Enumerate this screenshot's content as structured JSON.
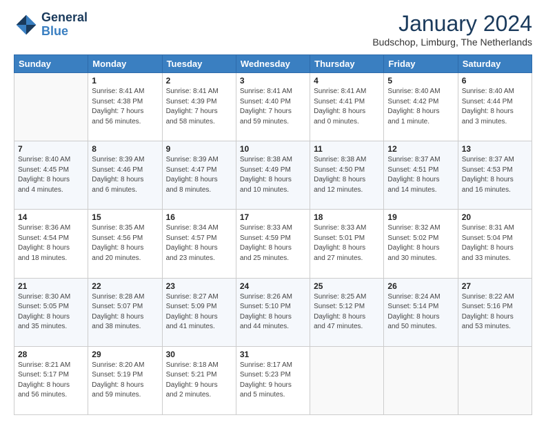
{
  "header": {
    "logo_line1": "General",
    "logo_line2": "Blue",
    "month_title": "January 2024",
    "location": "Budschop, Limburg, The Netherlands"
  },
  "days_of_week": [
    "Sunday",
    "Monday",
    "Tuesday",
    "Wednesday",
    "Thursday",
    "Friday",
    "Saturday"
  ],
  "weeks": [
    [
      {
        "day": "",
        "info": ""
      },
      {
        "day": "1",
        "info": "Sunrise: 8:41 AM\nSunset: 4:38 PM\nDaylight: 7 hours\nand 56 minutes."
      },
      {
        "day": "2",
        "info": "Sunrise: 8:41 AM\nSunset: 4:39 PM\nDaylight: 7 hours\nand 58 minutes."
      },
      {
        "day": "3",
        "info": "Sunrise: 8:41 AM\nSunset: 4:40 PM\nDaylight: 7 hours\nand 59 minutes."
      },
      {
        "day": "4",
        "info": "Sunrise: 8:41 AM\nSunset: 4:41 PM\nDaylight: 8 hours\nand 0 minutes."
      },
      {
        "day": "5",
        "info": "Sunrise: 8:40 AM\nSunset: 4:42 PM\nDaylight: 8 hours\nand 1 minute."
      },
      {
        "day": "6",
        "info": "Sunrise: 8:40 AM\nSunset: 4:44 PM\nDaylight: 8 hours\nand 3 minutes."
      }
    ],
    [
      {
        "day": "7",
        "info": "Sunrise: 8:40 AM\nSunset: 4:45 PM\nDaylight: 8 hours\nand 4 minutes."
      },
      {
        "day": "8",
        "info": "Sunrise: 8:39 AM\nSunset: 4:46 PM\nDaylight: 8 hours\nand 6 minutes."
      },
      {
        "day": "9",
        "info": "Sunrise: 8:39 AM\nSunset: 4:47 PM\nDaylight: 8 hours\nand 8 minutes."
      },
      {
        "day": "10",
        "info": "Sunrise: 8:38 AM\nSunset: 4:49 PM\nDaylight: 8 hours\nand 10 minutes."
      },
      {
        "day": "11",
        "info": "Sunrise: 8:38 AM\nSunset: 4:50 PM\nDaylight: 8 hours\nand 12 minutes."
      },
      {
        "day": "12",
        "info": "Sunrise: 8:37 AM\nSunset: 4:51 PM\nDaylight: 8 hours\nand 14 minutes."
      },
      {
        "day": "13",
        "info": "Sunrise: 8:37 AM\nSunset: 4:53 PM\nDaylight: 8 hours\nand 16 minutes."
      }
    ],
    [
      {
        "day": "14",
        "info": "Sunrise: 8:36 AM\nSunset: 4:54 PM\nDaylight: 8 hours\nand 18 minutes."
      },
      {
        "day": "15",
        "info": "Sunrise: 8:35 AM\nSunset: 4:56 PM\nDaylight: 8 hours\nand 20 minutes."
      },
      {
        "day": "16",
        "info": "Sunrise: 8:34 AM\nSunset: 4:57 PM\nDaylight: 8 hours\nand 23 minutes."
      },
      {
        "day": "17",
        "info": "Sunrise: 8:33 AM\nSunset: 4:59 PM\nDaylight: 8 hours\nand 25 minutes."
      },
      {
        "day": "18",
        "info": "Sunrise: 8:33 AM\nSunset: 5:01 PM\nDaylight: 8 hours\nand 27 minutes."
      },
      {
        "day": "19",
        "info": "Sunrise: 8:32 AM\nSunset: 5:02 PM\nDaylight: 8 hours\nand 30 minutes."
      },
      {
        "day": "20",
        "info": "Sunrise: 8:31 AM\nSunset: 5:04 PM\nDaylight: 8 hours\nand 33 minutes."
      }
    ],
    [
      {
        "day": "21",
        "info": "Sunrise: 8:30 AM\nSunset: 5:05 PM\nDaylight: 8 hours\nand 35 minutes."
      },
      {
        "day": "22",
        "info": "Sunrise: 8:28 AM\nSunset: 5:07 PM\nDaylight: 8 hours\nand 38 minutes."
      },
      {
        "day": "23",
        "info": "Sunrise: 8:27 AM\nSunset: 5:09 PM\nDaylight: 8 hours\nand 41 minutes."
      },
      {
        "day": "24",
        "info": "Sunrise: 8:26 AM\nSunset: 5:10 PM\nDaylight: 8 hours\nand 44 minutes."
      },
      {
        "day": "25",
        "info": "Sunrise: 8:25 AM\nSunset: 5:12 PM\nDaylight: 8 hours\nand 47 minutes."
      },
      {
        "day": "26",
        "info": "Sunrise: 8:24 AM\nSunset: 5:14 PM\nDaylight: 8 hours\nand 50 minutes."
      },
      {
        "day": "27",
        "info": "Sunrise: 8:22 AM\nSunset: 5:16 PM\nDaylight: 8 hours\nand 53 minutes."
      }
    ],
    [
      {
        "day": "28",
        "info": "Sunrise: 8:21 AM\nSunset: 5:17 PM\nDaylight: 8 hours\nand 56 minutes."
      },
      {
        "day": "29",
        "info": "Sunrise: 8:20 AM\nSunset: 5:19 PM\nDaylight: 8 hours\nand 59 minutes."
      },
      {
        "day": "30",
        "info": "Sunrise: 8:18 AM\nSunset: 5:21 PM\nDaylight: 9 hours\nand 2 minutes."
      },
      {
        "day": "31",
        "info": "Sunrise: 8:17 AM\nSunset: 5:23 PM\nDaylight: 9 hours\nand 5 minutes."
      },
      {
        "day": "",
        "info": ""
      },
      {
        "day": "",
        "info": ""
      },
      {
        "day": "",
        "info": ""
      }
    ]
  ]
}
